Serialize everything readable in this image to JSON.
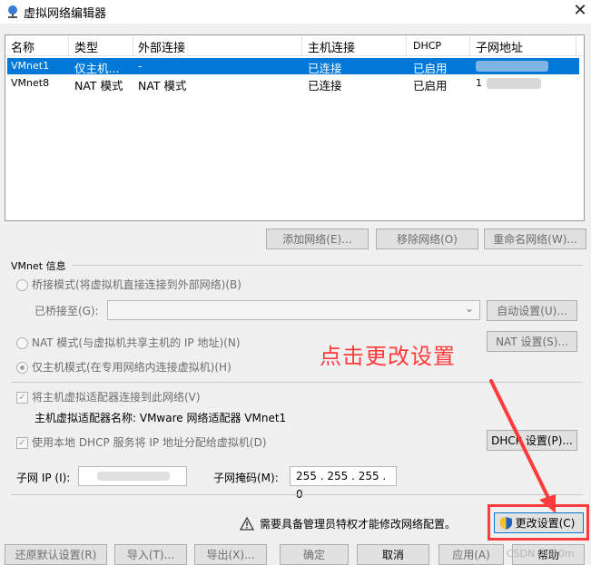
{
  "window": {
    "title": "虚拟网络编辑器",
    "close_glyph": "✕"
  },
  "table": {
    "headers": [
      "名称",
      "类型",
      "外部连接",
      "主机连接",
      "DHCP",
      "子网地址"
    ],
    "rows": [
      {
        "name": "VMnet1",
        "type": "仅主机...",
        "external": "-",
        "host": "已连接",
        "dhcp": "已启用",
        "subnet": "",
        "selected": true
      },
      {
        "name": "VMnet8",
        "type": "NAT 模式",
        "external": "NAT 模式",
        "host": "已连接",
        "dhcp": "已启用",
        "subnet": "1",
        "selected": false
      }
    ]
  },
  "table_buttons": {
    "add": "添加网络(E)...",
    "remove": "移除网络(O)",
    "rename": "重命名网络(W)..."
  },
  "vmnet_info": {
    "heading": "VMnet 信息",
    "bridge_mode": "桥接模式(将虚拟机直接连接到外部网络)(B)",
    "bridge_to_label": "已桥接至(G):",
    "auto_settings": "自动设置(U)...",
    "nat_mode": "NAT 模式(与虚拟机共享主机的 IP 地址)(N)",
    "nat_settings": "NAT 设置(S)...",
    "host_only_mode": "仅主机模式(在专用网络内连接虚拟机)(H)",
    "connect_adapter": "将主机虚拟适配器连接到此网络(V)",
    "adapter_name": "主机虚拟适配器名称: VMware 网络适配器 VMnet1",
    "use_dhcp": "使用本地 DHCP 服务将 IP 地址分配给虚拟机(D)",
    "dhcp_settings": "DHCP 设置(P)...",
    "subnet_ip_label": "子网 IP (I):",
    "subnet_mask_label": "子网掩码(M):",
    "subnet_mask_value": "255 . 255 . 255 . 0"
  },
  "admin": {
    "warning": "需要具备管理员特权才能修改网络配置。",
    "change_settings": "更改设置(C)"
  },
  "footer_buttons": {
    "restore": "还原默认设置(R)",
    "import": "导入(T)...",
    "export": "导出(X)...",
    "ok": "确定",
    "cancel": "取消",
    "apply": "应用(A)",
    "help": "帮助"
  },
  "annotation": {
    "text": "点击更改设置",
    "color": "#ff3b3b"
  },
  "watermark": "CSDN @哈0m",
  "colors": {
    "selection": "#0078d7",
    "accent_red": "#ff3b3b"
  }
}
